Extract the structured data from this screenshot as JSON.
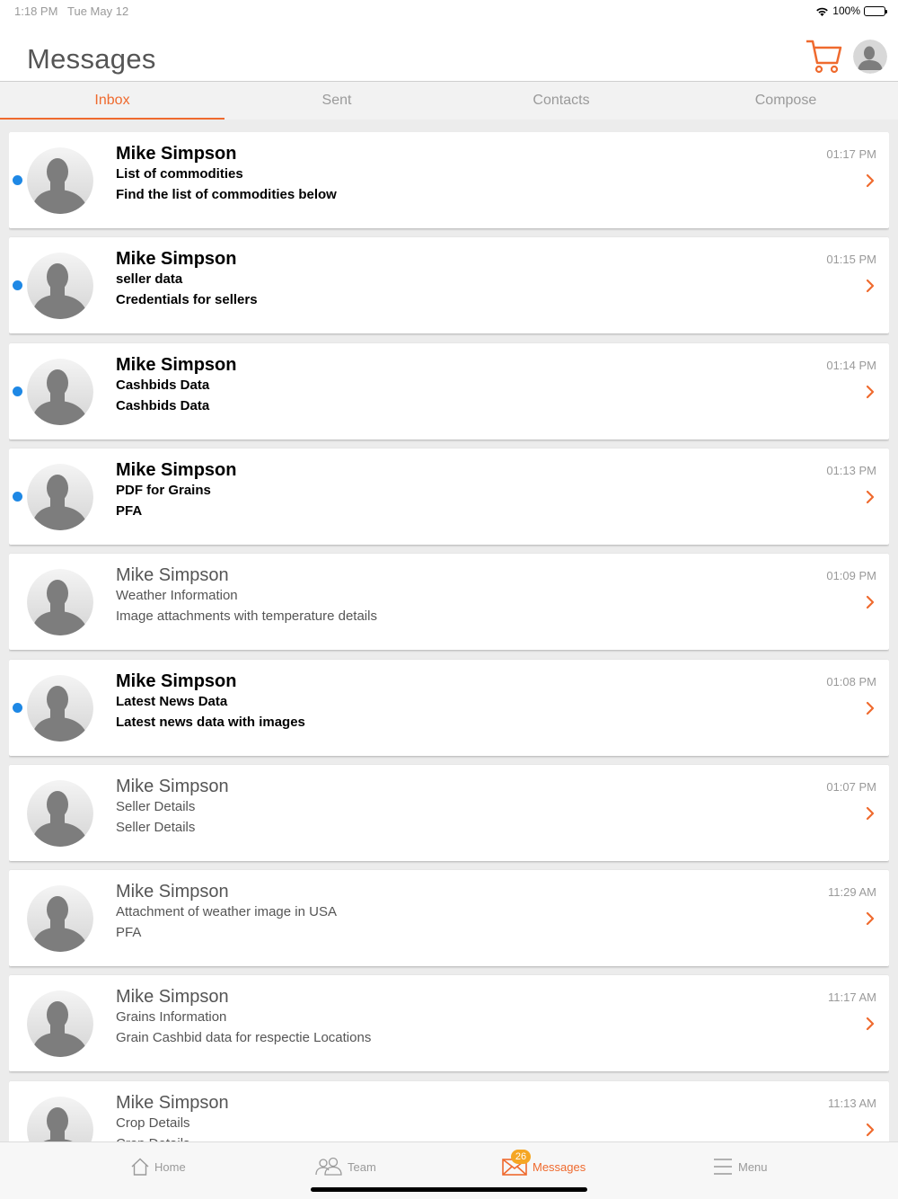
{
  "status": {
    "time": "1:18 PM",
    "date": "Tue May 12",
    "battery": "100%"
  },
  "header": {
    "title": "Messages"
  },
  "tabs": [
    {
      "label": "Inbox",
      "active": true
    },
    {
      "label": "Sent",
      "active": false
    },
    {
      "label": "Contacts",
      "active": false
    },
    {
      "label": "Compose",
      "active": false
    }
  ],
  "messages": [
    {
      "sender": "Mike Simpson",
      "subject": "List of commodities",
      "preview": "Find the list of commodities below",
      "time": "01:17 PM",
      "unread": true
    },
    {
      "sender": "Mike Simpson",
      "subject": "seller data",
      "preview": "Credentials for sellers",
      "time": "01:15 PM",
      "unread": true
    },
    {
      "sender": "Mike Simpson",
      "subject": "Cashbids Data",
      "preview": "Cashbids Data",
      "time": "01:14 PM",
      "unread": true
    },
    {
      "sender": "Mike Simpson",
      "subject": "PDF for Grains",
      "preview": "PFA",
      "time": "01:13 PM",
      "unread": true
    },
    {
      "sender": "Mike Simpson",
      "subject": "Weather Information",
      "preview": "Image attachments with temperature details",
      "time": "01:09 PM",
      "unread": false
    },
    {
      "sender": "Mike Simpson",
      "subject": "Latest News Data",
      "preview": "Latest news data with images",
      "time": "01:08 PM",
      "unread": true
    },
    {
      "sender": "Mike Simpson",
      "subject": "Seller Details",
      "preview": "Seller Details",
      "time": "01:07 PM",
      "unread": false
    },
    {
      "sender": "Mike Simpson",
      "subject": "Attachment of weather image in USA",
      "preview": "PFA",
      "time": "11:29 AM",
      "unread": false
    },
    {
      "sender": "Mike Simpson",
      "subject": "Grains Information",
      "preview": "Grain Cashbid data for respectie Locations",
      "time": "11:17 AM",
      "unread": false
    },
    {
      "sender": "Mike Simpson",
      "subject": "Crop Details",
      "preview": "Crop Details",
      "time": "11:13 AM",
      "unread": false
    }
  ],
  "tabbar": {
    "home": "Home",
    "team": "Team",
    "messages": "Messages",
    "messages_badge": "26",
    "menu": "Menu"
  },
  "colors": {
    "accent": "#ef6a2e",
    "unread_dot": "#1e88e5",
    "badge": "#f5a623"
  }
}
